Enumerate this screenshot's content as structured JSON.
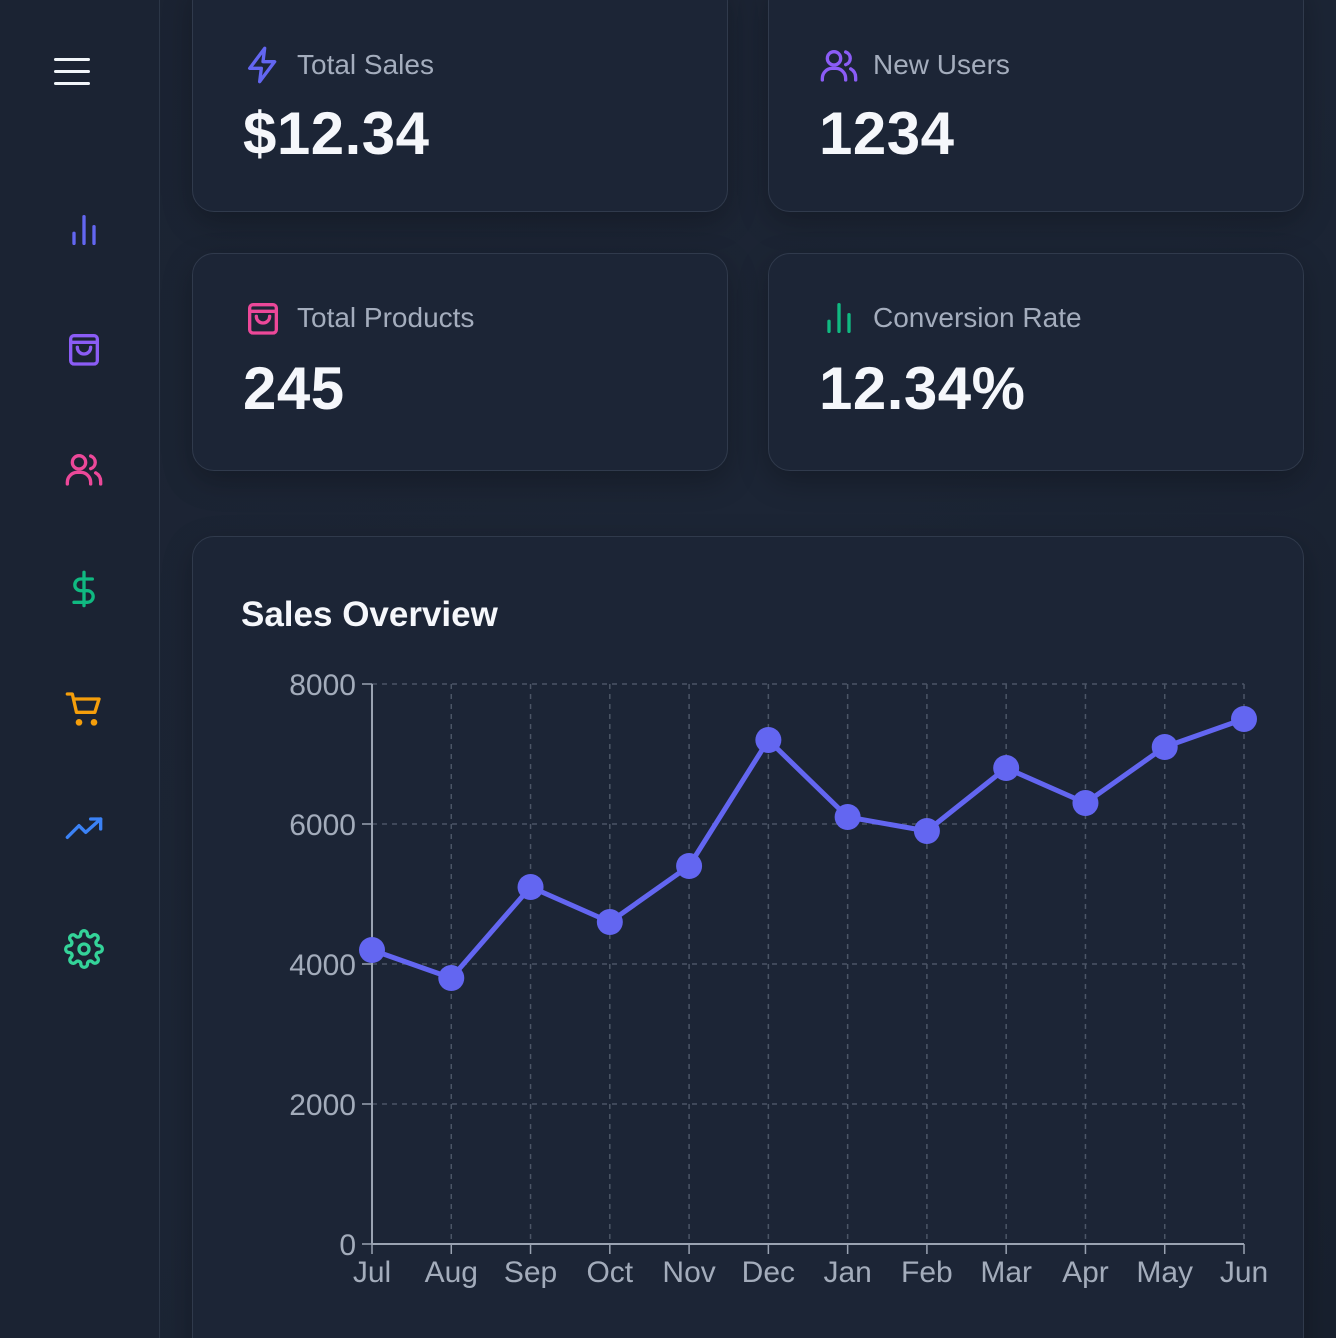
{
  "sidebar": {
    "menu_icon": "hamburger-menu-icon",
    "items": [
      {
        "icon": "bar-chart-icon",
        "color": "#6366f1"
      },
      {
        "icon": "shopping-bag-icon",
        "color": "#8b5cf6"
      },
      {
        "icon": "users-icon",
        "color": "#ec4899"
      },
      {
        "icon": "dollar-icon",
        "color": "#10b981"
      },
      {
        "icon": "shopping-cart-icon",
        "color": "#f59e0b"
      },
      {
        "icon": "trending-up-icon",
        "color": "#3b82f6"
      },
      {
        "icon": "settings-icon",
        "color": "#34d399"
      }
    ]
  },
  "stats": [
    {
      "label": "Total Sales",
      "value": "$12.34",
      "icon": "lightning-icon",
      "color": "#6366f1"
    },
    {
      "label": "New Users",
      "value": "1234",
      "icon": "users-icon",
      "color": "#8b5cf6"
    },
    {
      "label": "Total Products",
      "value": "245",
      "icon": "shopping-bag-icon",
      "color": "#ec4899"
    },
    {
      "label": "Conversion Rate",
      "value": "12.34%",
      "icon": "bar-chart-icon",
      "color": "#10b981"
    }
  ],
  "chart": {
    "title": "Sales Overview"
  },
  "chart_data": {
    "type": "line",
    "title": "Sales Overview",
    "categories": [
      "Jul",
      "Aug",
      "Sep",
      "Oct",
      "Nov",
      "Dec",
      "Jan",
      "Feb",
      "Mar",
      "Apr",
      "May",
      "Jun"
    ],
    "series": [
      {
        "values": [
          4200,
          3800,
          5100,
          4600,
          5400,
          7200,
          6100,
          5900,
          6800,
          6300,
          7100,
          7500
        ],
        "color": "#6366f1"
      }
    ],
    "yticks": [
      "0",
      "2000",
      "4000",
      "6000",
      "8000"
    ],
    "ylim": [
      0,
      8000
    ],
    "grid": true,
    "xlabel": "",
    "ylabel": ""
  }
}
